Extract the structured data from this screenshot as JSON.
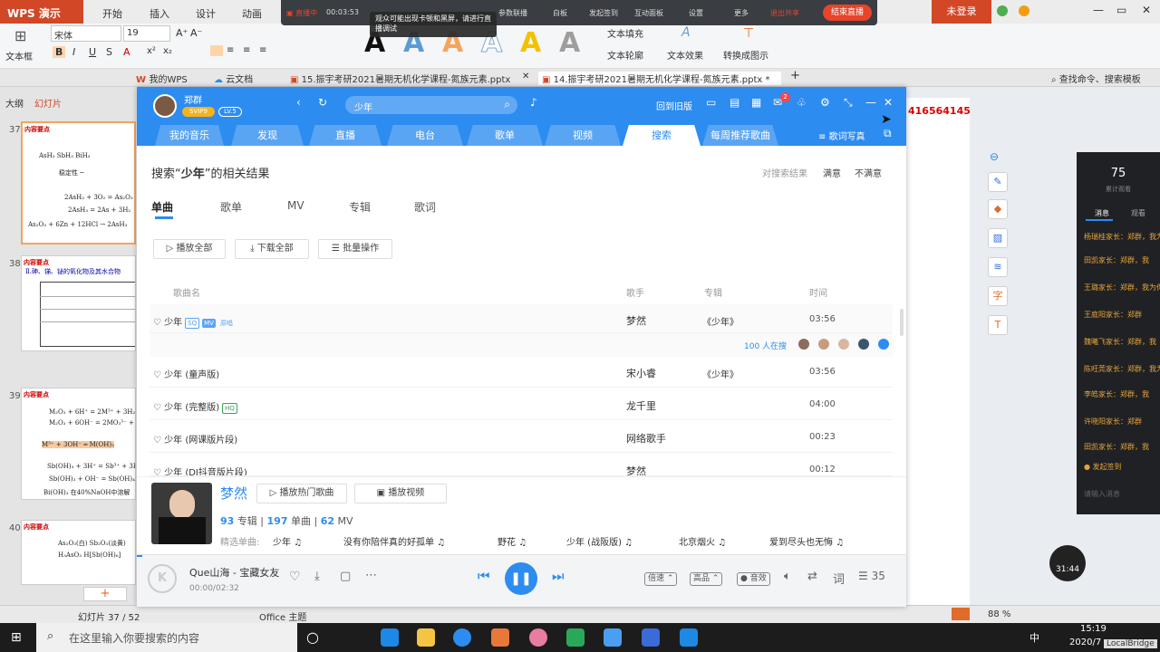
{
  "wps": {
    "logo": "WPS 演示",
    "tabs": [
      "开始",
      "插入",
      "设计",
      "动画"
    ],
    "login": "未登录",
    "ribbon": {
      "font_name": "宋体",
      "font_size": "19",
      "text_box": "文本框",
      "text_fill": "文本填充",
      "text_outline": "文本轮廓",
      "text_effect": "文本效果",
      "convert_image": "转换成图示"
    },
    "doc_tabs": [
      "我的WPS",
      "云文档",
      "15.振宇考研2021暑期无机化学课程-氮族元素.pptx",
      "14.振宇考研2021暑期无机化学课程-氮族元素.pptx *"
    ],
    "search_cmd": "查找命令、搜索模板",
    "panel_tabs": [
      "大纲",
      "幻灯片"
    ],
    "slide_nums": [
      "37",
      "38",
      "39",
      "40"
    ],
    "status_left": "幻灯片 37 / 52",
    "status_theme": "Office 主题",
    "zoom": "88 %",
    "red_text": "416564145"
  },
  "live": {
    "status": "直播中",
    "time": "00:03:53",
    "items": [
      "白板",
      "发起签到",
      "互动面板",
      "设置",
      "更多"
    ],
    "share": "退出共享",
    "end": "结束直播",
    "tip": "观众可能出现卡顿和黑屏，请进行直播调试",
    "record": "参数联播"
  },
  "chat": {
    "count": "75",
    "count_label": "累计观看",
    "tabs": [
      "消息",
      "观看"
    ],
    "msgs": [
      "杨瑞桂家长：郑群，我为你点赞！",
      "田凯家长：郑群，我",
      "王璐家长：郑群，我为你点赞！",
      "王庭阳家长：郑群",
      "魏曦飞家长：郑群，我",
      "陈旺莞家长：郑群，我为你点赞！",
      "李皓家长：郑群，我",
      "许晓阳家长：郑群",
      "田凯家长：郑群，我"
    ],
    "signin": "发起签到",
    "input": "请输入消息",
    "timer": "31:44"
  },
  "kugou": {
    "user": "郑群",
    "svip": "SVIP9",
    "level": "LV.5",
    "search_value": "少年",
    "back_old": "回到旧版",
    "notif_count": "2",
    "nav": [
      "我的音乐",
      "发现",
      "直播",
      "电台",
      "歌单",
      "视频",
      "搜索",
      "每周推荐歌曲"
    ],
    "lyric_btn": "歌词写真",
    "result_prefix": "搜索“",
    "result_keyword": "少年",
    "result_suffix": "”的相关结果",
    "feedback": [
      "对搜索结果",
      "满意",
      "不满意"
    ],
    "subtabs": [
      "单曲",
      "歌单",
      "MV",
      "专辑",
      "歌词"
    ],
    "actions": [
      "播放全部",
      "下载全部",
      "批量操作"
    ],
    "columns": [
      "歌曲名",
      "歌手",
      "专辑",
      "时间"
    ],
    "rows": [
      {
        "name": "少年",
        "badges": [
          "SQ",
          "MV",
          "原唱"
        ],
        "singer": "梦然",
        "album": "《少年》",
        "time": "03:56"
      },
      {
        "name": "少年 (童声版)",
        "badges": [],
        "singer": "宋小睿",
        "album": "《少年》",
        "time": "03:56"
      },
      {
        "name": "少年 (完整版)",
        "badges": [
          "HQ"
        ],
        "singer": "龙千里",
        "album": "",
        "time": "04:00"
      },
      {
        "name": "少年 (网课版片段)",
        "badges": [],
        "singer": "网络歌手",
        "album": "",
        "time": "00:23"
      },
      {
        "name": "少年 (DJ抖音版片段)",
        "badges": [],
        "singer": "梦然",
        "album": "",
        "time": "00:12"
      }
    ],
    "searching": "100 人在搜",
    "artist": {
      "name": "梦然",
      "play_hot": "播放热门歌曲",
      "play_video": "播放视频",
      "albums": "93",
      "albums_label": "专辑",
      "singles": "197",
      "singles_label": "单曲",
      "mvs": "62",
      "mvs_label": "MV",
      "picks_label": "精选单曲:",
      "picks": [
        "少年",
        "没有你陪伴真的好孤单",
        "野花",
        "少年 (战阪版)",
        "北京烟火",
        "爱到尽头也无悔"
      ]
    },
    "player": {
      "song": "Que山海 - 宝藏女友",
      "time": "00:00/02:32",
      "speed": "倍速",
      "quality": "高品",
      "effect": "音效",
      "lyric": "词",
      "queue_count": "35"
    }
  },
  "taskbar": {
    "search_placeholder": "在这里输入你要搜索的内容",
    "time": "15:19",
    "date": "2020/7",
    "ime": "中",
    "local": "LocalBridge"
  }
}
